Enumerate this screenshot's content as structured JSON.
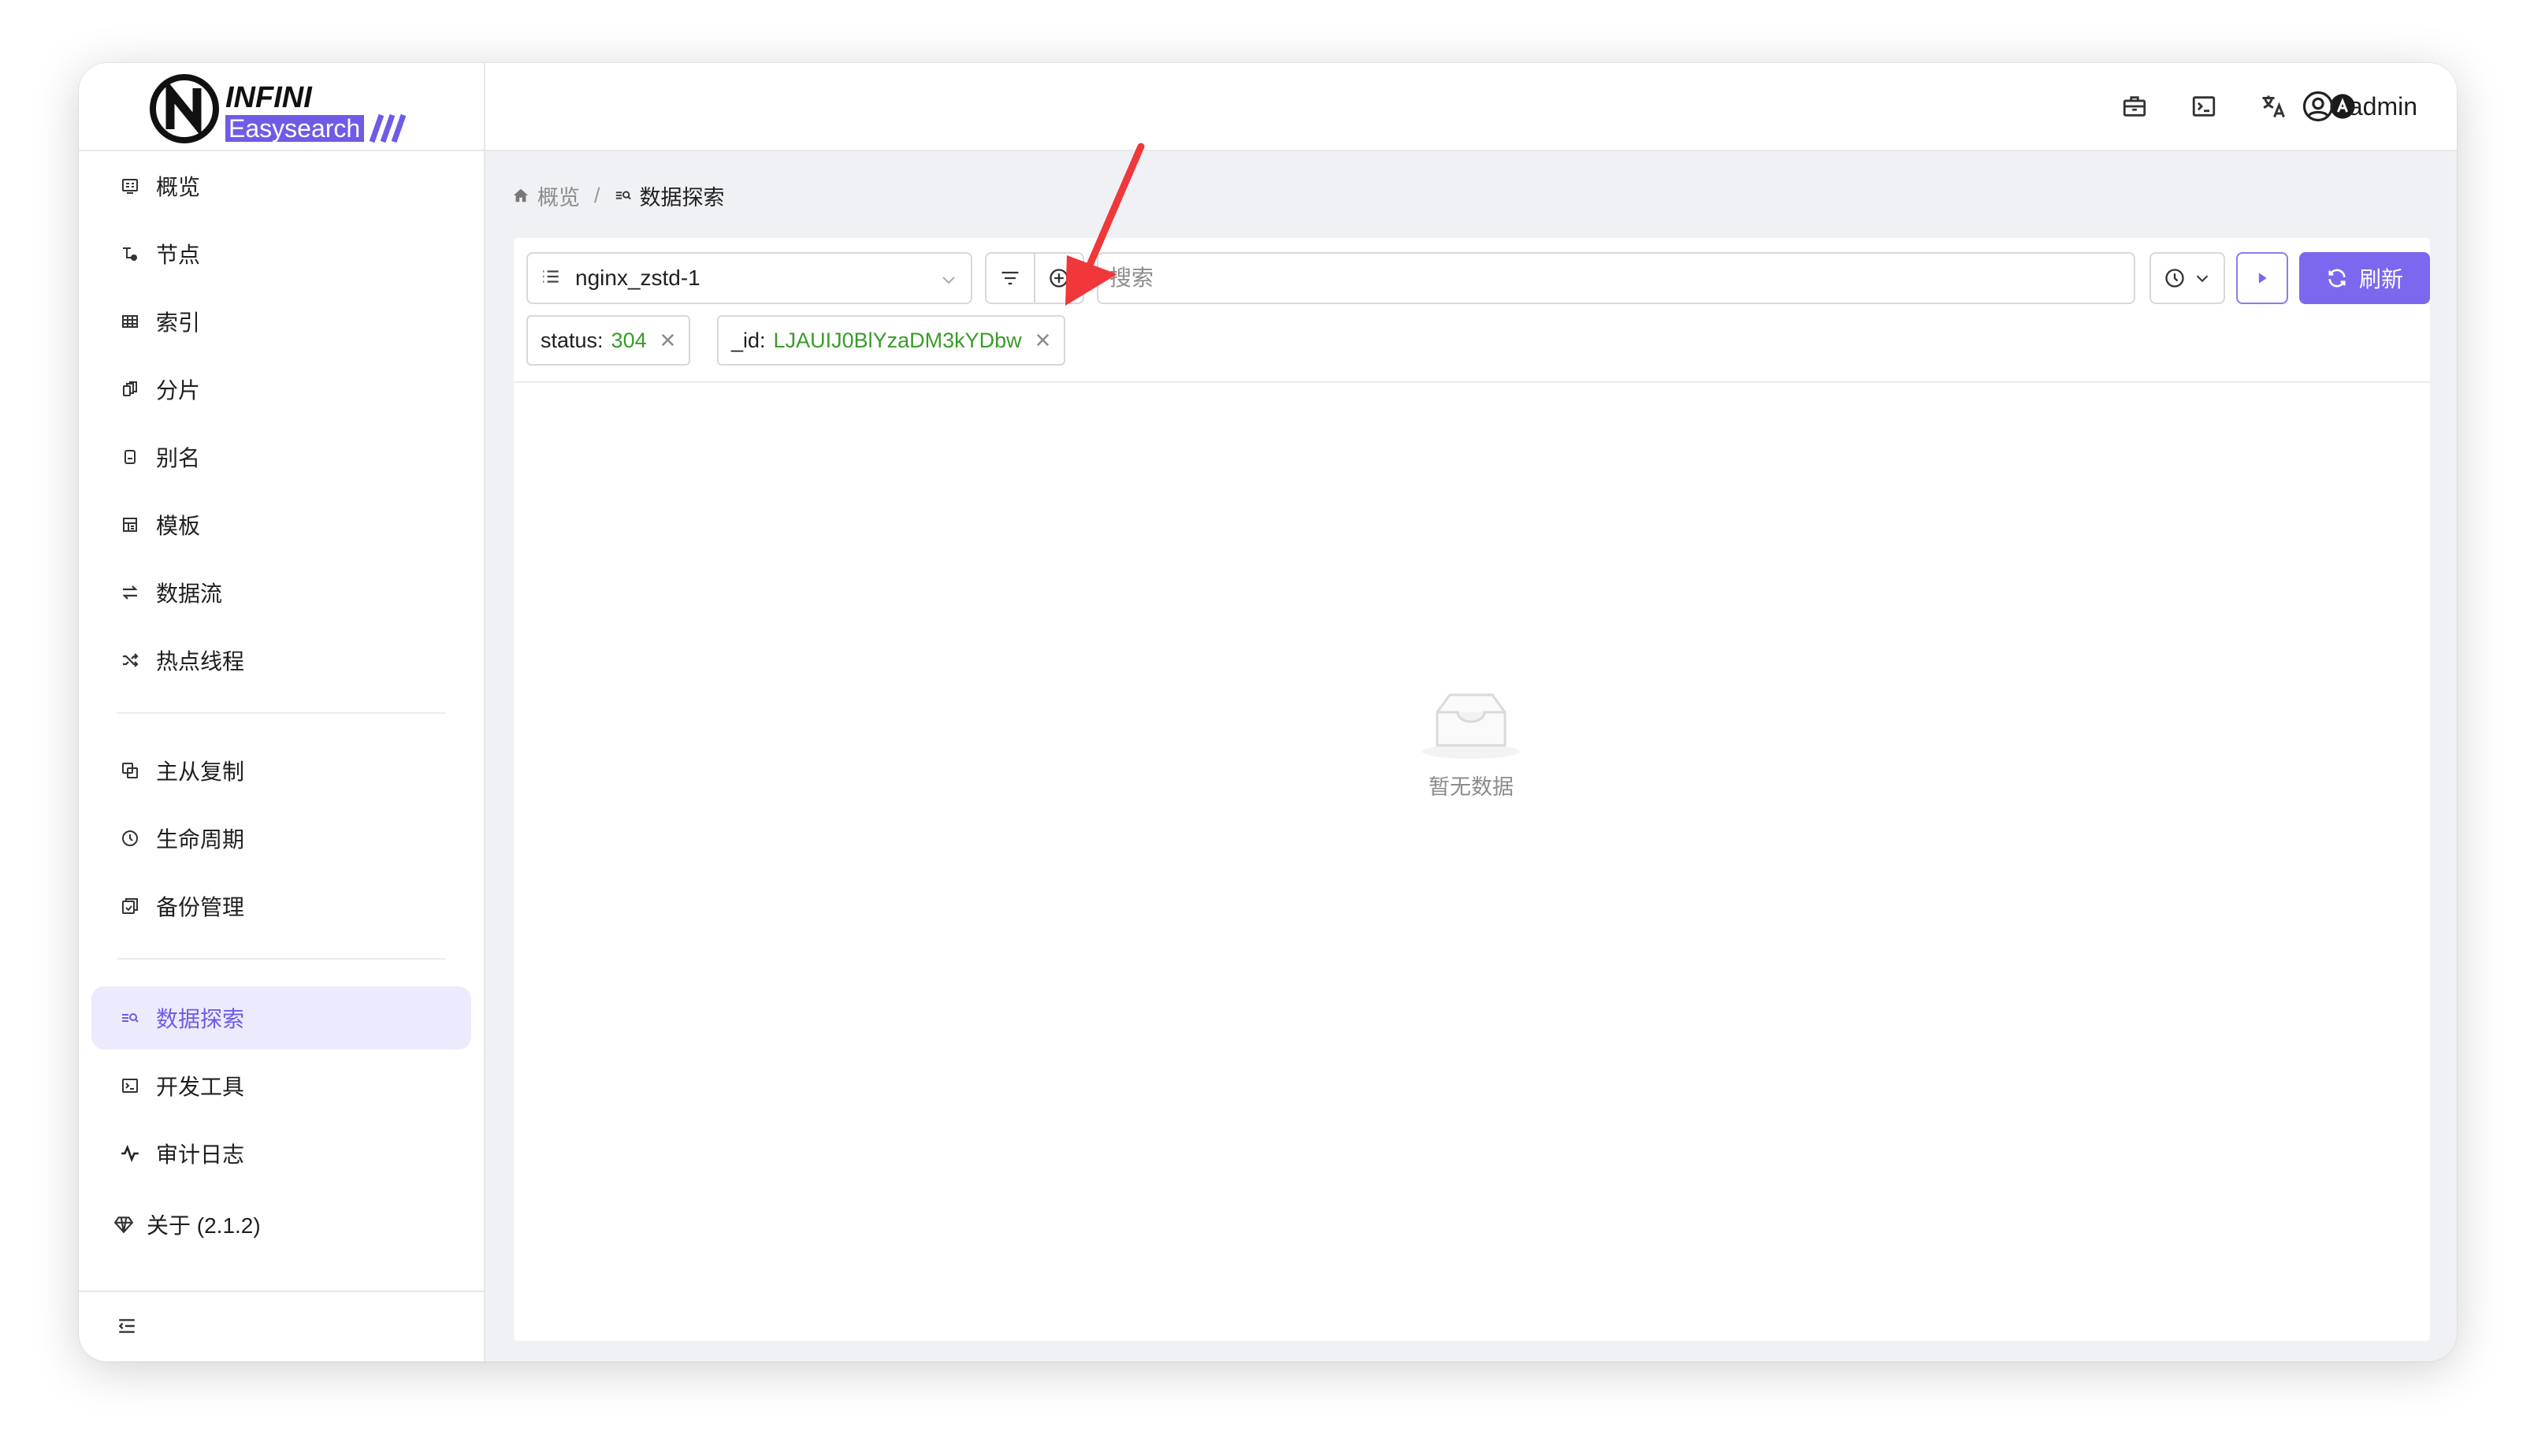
{
  "app": {
    "logo_line1": "INFINI",
    "logo_line2": "Easysearch",
    "accent_color": "#7b68ee"
  },
  "sidebar": {
    "group1": [
      {
        "label": "概览",
        "icon": "overview-icon"
      },
      {
        "label": "节点",
        "icon": "nodes-icon"
      },
      {
        "label": "索引",
        "icon": "table-icon"
      },
      {
        "label": "分片",
        "icon": "shards-icon"
      },
      {
        "label": "别名",
        "icon": "alias-icon"
      },
      {
        "label": "模板",
        "icon": "template-icon"
      },
      {
        "label": "数据流",
        "icon": "swap-icon"
      },
      {
        "label": "热点线程",
        "icon": "shuffle-icon"
      }
    ],
    "group2": [
      {
        "label": "主从复制",
        "icon": "copy-icon"
      },
      {
        "label": "生命周期",
        "icon": "clock-icon"
      },
      {
        "label": "备份管理",
        "icon": "backup-icon"
      }
    ],
    "group3": [
      {
        "label": "数据探索",
        "icon": "discover-icon",
        "active": true
      },
      {
        "label": "开发工具",
        "icon": "terminal-icon"
      },
      {
        "label": "审计日志",
        "icon": "pulse-icon"
      }
    ],
    "about": "关于 (2.1.2)"
  },
  "header": {
    "icons": [
      "briefcase-icon",
      "terminal-icon",
      "translate-icon",
      "theme-icon"
    ],
    "user": "admin"
  },
  "breadcrumb": {
    "home": "概览",
    "separator": "/",
    "current": "数据探索"
  },
  "toolbar": {
    "index_value": "nginx_zstd-1",
    "search_placeholder": "搜索",
    "refresh_label": "刷新"
  },
  "filters": [
    {
      "key": "status:",
      "value": "304"
    },
    {
      "key": "_id:",
      "value": "LJAUIJ0BlYzaDM3kYDbw"
    }
  ],
  "empty_text": "暂无数据"
}
